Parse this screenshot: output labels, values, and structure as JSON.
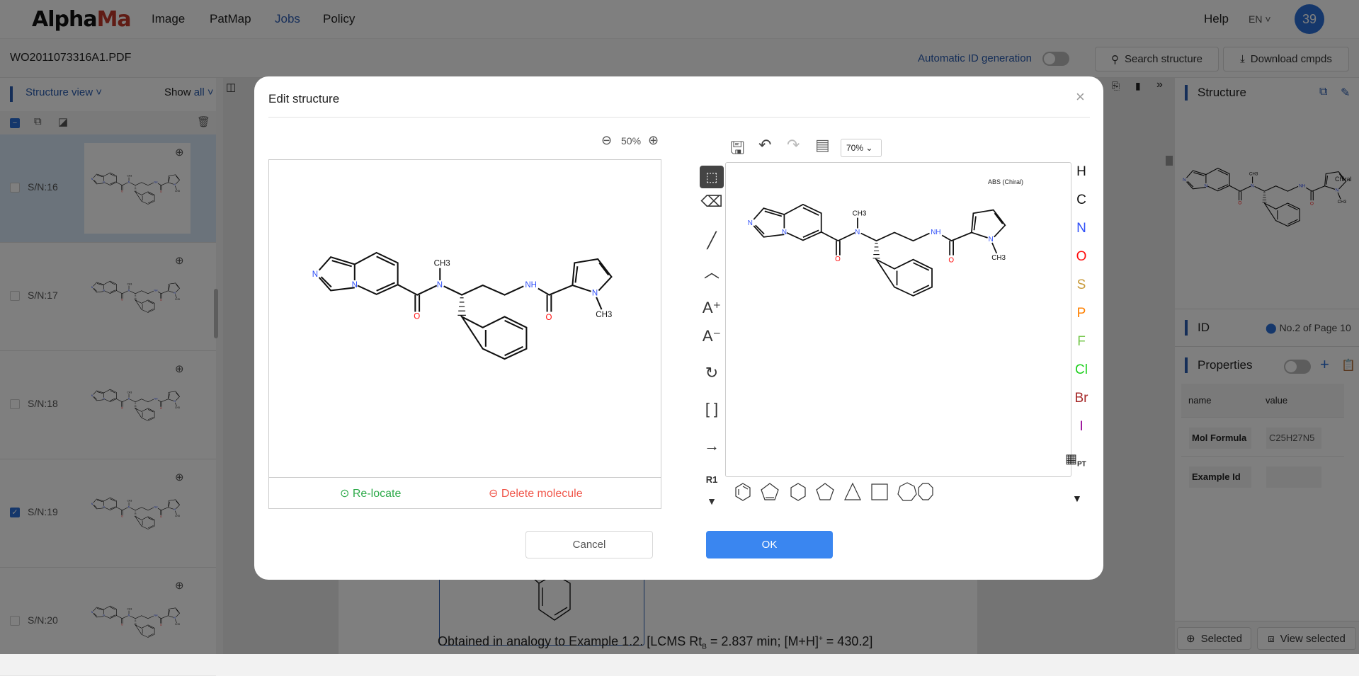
{
  "nav": {
    "logo": "AlphaMa",
    "logo_a": "Alpha",
    "logo_b": "Ma",
    "items": [
      {
        "label": "Image"
      },
      {
        "label": "PatMap"
      },
      {
        "label": "Jobs",
        "active": true
      },
      {
        "label": "Policy"
      }
    ],
    "help": "Help",
    "lang": "EN",
    "avatar": "39"
  },
  "toolbar": {
    "filename": "WO2011073316A1.PDF",
    "auto_id": "Automatic ID generation",
    "auto_id_on": false,
    "search": "Search structure",
    "download": "Download cmpds"
  },
  "left": {
    "view": "Structure view",
    "show": "Show",
    "show_value": "all",
    "items": [
      {
        "sn": "S/N:16",
        "checked": false,
        "selected": true
      },
      {
        "sn": "S/N:17",
        "checked": false
      },
      {
        "sn": "S/N:18",
        "checked": false
      },
      {
        "sn": "S/N:19",
        "checked": true
      },
      {
        "sn": "S/N:20",
        "checked": false
      }
    ]
  },
  "document": {
    "caption": "Obtained in analogy to Example 1.2. [LCMS Rt",
    "caption_sub": "B",
    "caption_mid": " = 2.837 min; [M+H]",
    "caption_sup": "+",
    "caption_end": " = 430.2]"
  },
  "right": {
    "structure": "Structure",
    "chiral": "Chiral",
    "id": "ID",
    "location": "No.2 of Page 10",
    "properties": "Properties",
    "columns": [
      "name",
      "value"
    ],
    "rows": [
      {
        "name": "Mol Formula",
        "value": "C25H27N5"
      },
      {
        "name": "Example Id",
        "value": ""
      }
    ],
    "selected_btn": "Selected",
    "view_selected_btn": "View selected"
  },
  "modal": {
    "title": "Edit structure",
    "zoom": "50%",
    "relocate": "Re-locate",
    "delete": "Delete molecule",
    "editor_zoom": "70%",
    "abs_label": "ABS (Chiral)",
    "r1": "R1",
    "pt": "PT",
    "elements": [
      {
        "s": "H",
        "c": "#111111"
      },
      {
        "s": "C",
        "c": "#111111"
      },
      {
        "s": "N",
        "c": "#3050f8"
      },
      {
        "s": "O",
        "c": "#ff0d0d"
      },
      {
        "s": "S",
        "c": "#c89a3a"
      },
      {
        "s": "P",
        "c": "#ff8000"
      },
      {
        "s": "F",
        "c": "#78c850"
      },
      {
        "s": "Cl",
        "c": "#1fd01f"
      },
      {
        "s": "Br",
        "c": "#a62929"
      },
      {
        "s": "I",
        "c": "#940094"
      }
    ],
    "cancel": "Cancel",
    "ok": "OK"
  },
  "molecule": {
    "n1": "N",
    "n2": "N",
    "n3": "N",
    "ch3a": "CH3",
    "o1": "O",
    "nh": "NH",
    "o2": "O",
    "n4": "N",
    "ch3b": "CH3"
  },
  "colors": {
    "accent": "#2a6fd6",
    "ok": "#3a86f0",
    "relocate": "#2eaa4a",
    "delete": "#f0564a"
  }
}
